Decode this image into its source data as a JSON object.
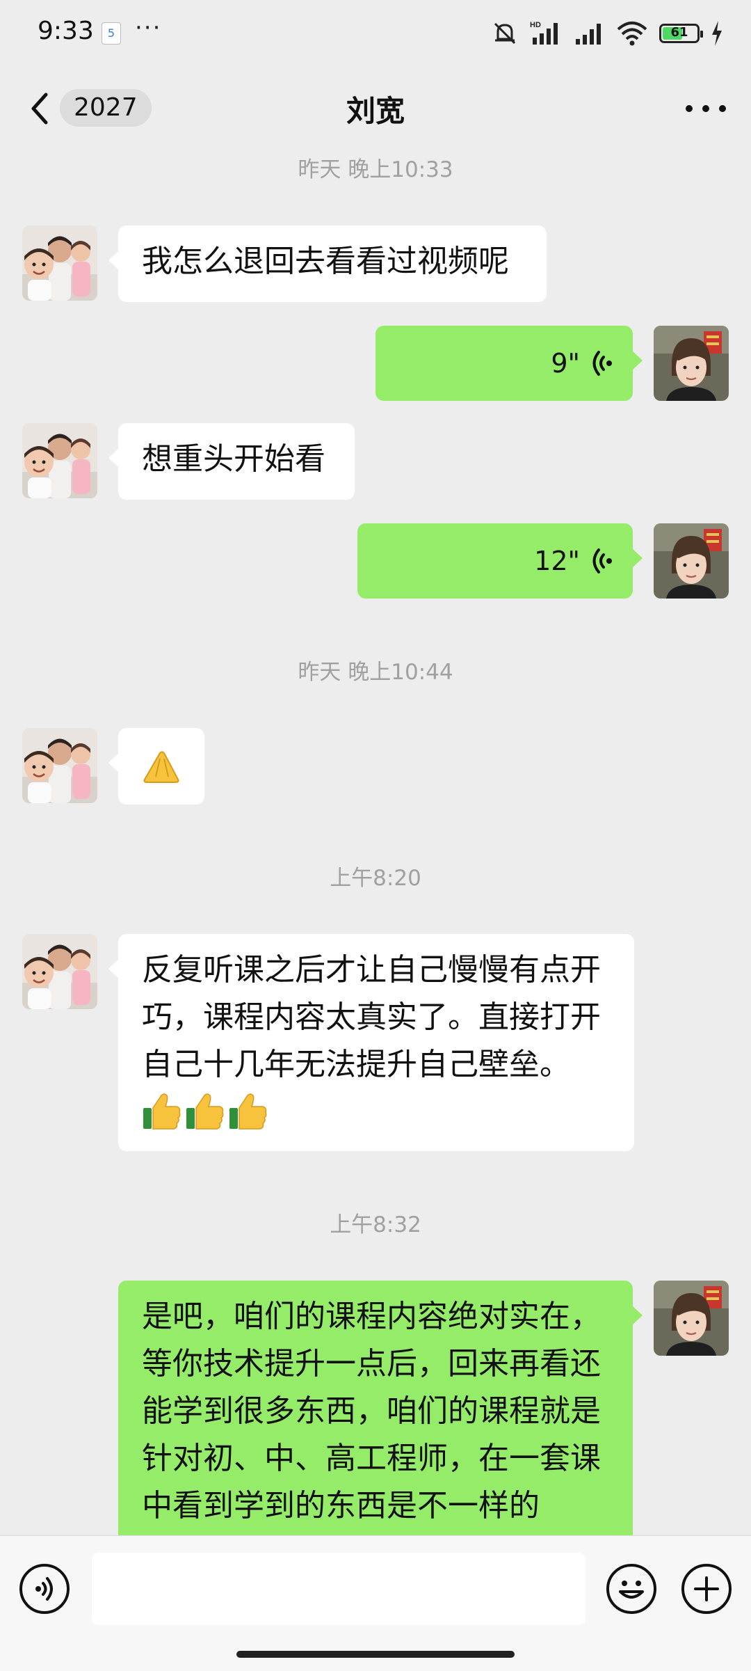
{
  "status_bar": {
    "time": "9:33",
    "app_badge": "5",
    "dots": "···",
    "battery": "61",
    "battery_level": 0.61
  },
  "header": {
    "unread_count": "2027",
    "title": "刘宽"
  },
  "messages": {
    "ts1": "昨天 晚上10:33",
    "m1": "我怎么退回去看看过视频呢",
    "v1": "9\"",
    "m2": "想重头开始看",
    "v2": "12\"",
    "ts2": "昨天 晚上10:44",
    "ts3": "上午8:20",
    "m4": "反复听课之后才让自己慢慢有点开巧，课程内容太真实了。直接打开自己十几年无法提升自己壁垒。",
    "m4_emoji": "👍👍👍",
    "ts4": "上午8:32",
    "m5": "是吧，咱们的课程内容绝对实在，等你技术提升一点后，回来再看还能学到很多东西，咱们的课程就是针对初、中、高工程师，在一套课中看到学到的东西是不一样的"
  },
  "input_bar": {
    "value": "",
    "placeholder": ""
  },
  "colors": {
    "background": "#ededed",
    "bubble_self": "#95ec69",
    "bubble_other": "#ffffff",
    "timestamp": "#a0a0a0"
  }
}
